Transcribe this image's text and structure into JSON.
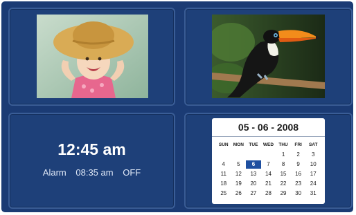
{
  "clock": {
    "time": "12:45 am",
    "alarm_label": "Alarm",
    "alarm_time": "08:35 am",
    "alarm_state": "OFF"
  },
  "calendar": {
    "date": "05 - 06 - 2008",
    "weekdays": [
      "SUN",
      "MON",
      "TUE",
      "WED",
      "THU",
      "FRI",
      "SAT"
    ],
    "days": [
      "",
      "",
      "",
      "",
      "1",
      "2",
      "3",
      "4",
      "5",
      "6",
      "7",
      "8",
      "9",
      "10",
      "11",
      "12",
      "13",
      "14",
      "15",
      "16",
      "17",
      "18",
      "19",
      "20",
      "21",
      "22",
      "23",
      "24",
      "25",
      "26",
      "27",
      "28",
      "29",
      "30",
      "31"
    ],
    "selected_day": "6"
  },
  "photos": {
    "left": "child-in-straw-hat",
    "right": "toucan-on-branch"
  },
  "colors": {
    "background": "#1b3b74",
    "panel_border": "#3a5d96",
    "highlight": "#1e4fa0"
  }
}
